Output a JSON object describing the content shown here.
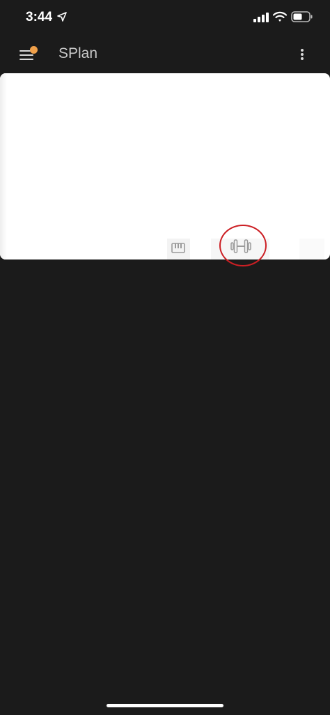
{
  "status_bar": {
    "time": "3:44",
    "icons": [
      "location-arrow-icon",
      "cellular-signal-icon",
      "wifi-icon",
      "battery-icon"
    ]
  },
  "app_bar": {
    "title": "SPlan",
    "menu_icon": "hamburger-menu-icon",
    "menu_badge_color": "#f0a04a",
    "more_icon": "more-vertical-icon"
  },
  "tabs": [
    {
      "icon": "piano-icon"
    },
    {
      "icon": "dumbbell-icon"
    }
  ],
  "colors": {
    "background": "#1b1b1b",
    "card": "#ffffff",
    "highlight_ring": "#cc1f24"
  }
}
